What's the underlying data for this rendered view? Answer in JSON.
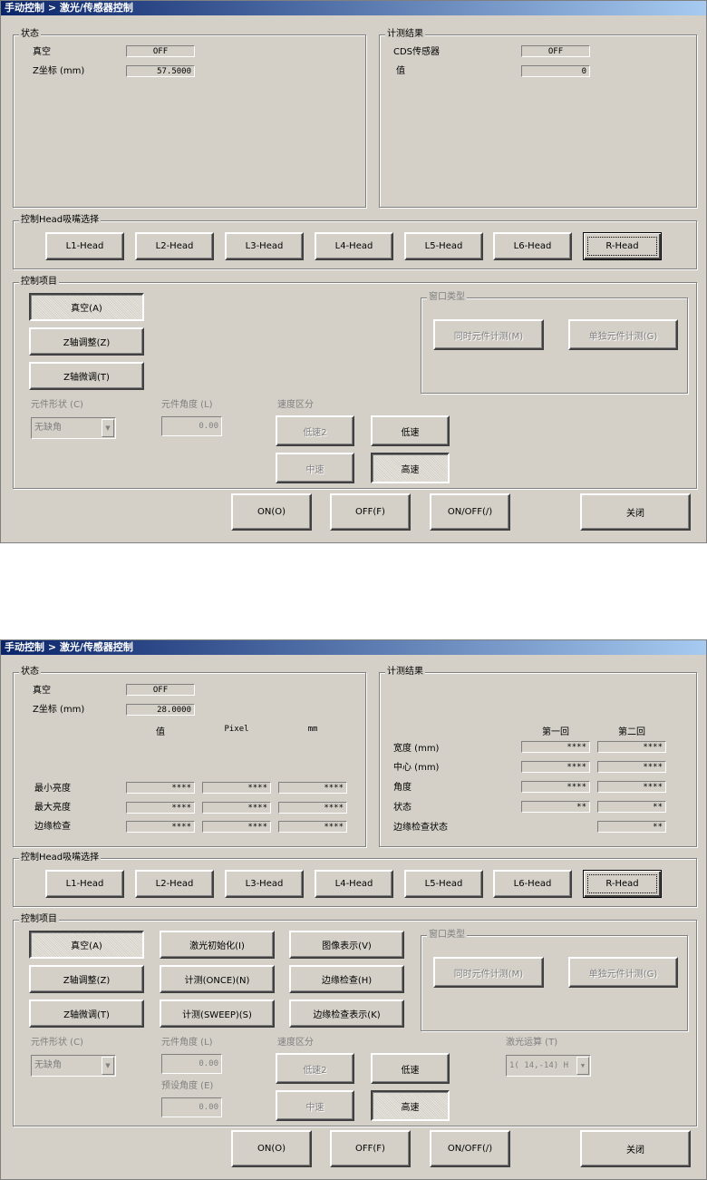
{
  "title": "手动控制 > 激光/传感器控制",
  "groups": {
    "status": "状态",
    "result": "计测结果",
    "head_select": "控制Head吸嘴选择",
    "control": "控制项目",
    "window_type": "窗口类型",
    "shape": "元件形状 (C)",
    "angle": "元件角度 (L)",
    "speed": "速度区分",
    "preset_angle": "预设角度 (E)",
    "laser_op": "激光运算 (T)"
  },
  "status": {
    "vacuum_label": "真空",
    "z_label": "Z坐标 (mm)"
  },
  "panel1": {
    "vacuum_value": "OFF",
    "z_value": "57.5000",
    "cds_label": "CDS传感器",
    "cds_value": "OFF",
    "value_label": "值",
    "value_value": "0"
  },
  "panel2": {
    "vacuum_value": "OFF",
    "z_value": "28.0000",
    "col_headers": [
      "值",
      "Pixel",
      "mm"
    ],
    "rows": [
      {
        "label": "最小亮度",
        "values": [
          "****",
          "****",
          "****"
        ]
      },
      {
        "label": "最大亮度",
        "values": [
          "****",
          "****",
          "****"
        ]
      },
      {
        "label": "边缘检查",
        "values": [
          "****",
          "****",
          "****"
        ]
      }
    ],
    "result_headers": [
      "第一回",
      "第二回"
    ],
    "result_rows": [
      {
        "label": "宽度 (mm)",
        "values": [
          "****",
          "****"
        ]
      },
      {
        "label": "中心 (mm)",
        "values": [
          "****",
          "****"
        ]
      },
      {
        "label": "角度",
        "values": [
          "****",
          "****"
        ]
      },
      {
        "label": "状态",
        "values": [
          "**",
          "**"
        ]
      }
    ],
    "edge_status_label": "边缘检查状态",
    "edge_status_value": "**",
    "laser_op_value": "1( 14,-14) H"
  },
  "heads": [
    "L1-Head",
    "L2-Head",
    "L3-Head",
    "L4-Head",
    "L5-Head",
    "L6-Head",
    "R-Head"
  ],
  "buttons": {
    "vacuum": "真空(A)",
    "z_adjust": "Z轴调整(Z)",
    "z_fine": "Z轴微调(T)",
    "sim_measure": "同时元件计测(M)",
    "single_measure": "单独元件计测(G)",
    "laser_init": "激光初始化(I)",
    "measure_once": "计测(ONCE)(N)",
    "measure_sweep": "计测(SWEEP)(S)",
    "image_show": "图像表示(V)",
    "edge_check": "边缘检查(H)",
    "edge_check_show": "边缘检查表示(K)",
    "low2": "低速2",
    "low": "低速",
    "mid": "中速",
    "high": "高速",
    "on": "ON(O)",
    "off": "OFF(F)",
    "onoff": "ON/OFF(/)",
    "close": "关闭"
  },
  "shape_value": "无缺角",
  "angle_value": "0.00",
  "preset_angle_value": "0.00"
}
